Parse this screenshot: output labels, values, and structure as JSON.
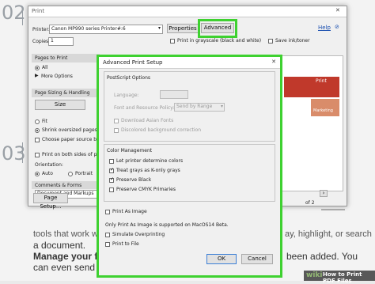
{
  "background": {
    "step_numbers": [
      "02",
      "03"
    ],
    "line1": "tools that work with",
    "line1_right": "ay, highlight, or search",
    "line2": "a document.",
    "line3_bold": "Manage your files.",
    "line3_right": "been added. You",
    "line4": "can even send remin"
  },
  "print_dialog": {
    "title": "Print",
    "help_label": "Help",
    "printer_label": "Printer:",
    "printer_value": "Canon MP990 series Printer#:6",
    "properties_label": "Properties",
    "advanced_label": "Advanced",
    "copies_label": "Copies:",
    "copies_value": "1",
    "grayscale_label": "Print in grayscale (black and white)",
    "save_ink_label": "Save ink/toner",
    "pages_to_print_header": "Pages to Print",
    "all_label": "All",
    "more_options_label": "More Options",
    "page_sizing_header": "Page Sizing & Handling",
    "size_label": "Size",
    "fit_label": "Fit",
    "shrink_label": "Shrink oversized pages",
    "choose_paper_label": "Choose paper source by",
    "both_sides_label": "Print on both sides of pa",
    "orientation_label": "Orientation:",
    "auto_label": "Auto",
    "portrait_label": "Portrait",
    "comments_header": "Comments & Forms",
    "comments_value": "Document and Markups",
    "page_setup_label": "Page Setup...",
    "preview_page_label": "of 2",
    "preview_right_text": "Print",
    "preview_doc_title": "Marketing",
    "cancel_label": "ncel"
  },
  "advanced_dialog": {
    "title": "Advanced Print Setup",
    "postscript_header": "PostScript Options",
    "language_label": "Language:",
    "font_policy_label": "Font and Resource Policy:",
    "font_policy_value": "Send by Range",
    "download_fonts_label": "Download Asian Fonts",
    "discolored_label": "Discolored background correction",
    "color_mgmt_header": "Color Management",
    "let_printer_label": "Let printer determine colors",
    "treat_grays_label": "Treat grays as K-only grays",
    "preserve_black_label": "Preserve Black",
    "preserve_cmyk_label": "Preserve CMYK Primaries",
    "print_as_image_label": "Print As Image",
    "macos_note": "Only Print As Image is supported on MacOS14 Beta.",
    "simulate_label": "Simulate Overprinting",
    "print_to_file_label": "Print to File",
    "ok_label": "OK",
    "cancel_label": "Cancel"
  },
  "footer": {
    "brand": "wiki",
    "title": "How to Print PDF Files"
  },
  "colors": {
    "highlight": "#3ed130",
    "wikihow_green": "#93b874",
    "preview_red": "#c0392b"
  }
}
